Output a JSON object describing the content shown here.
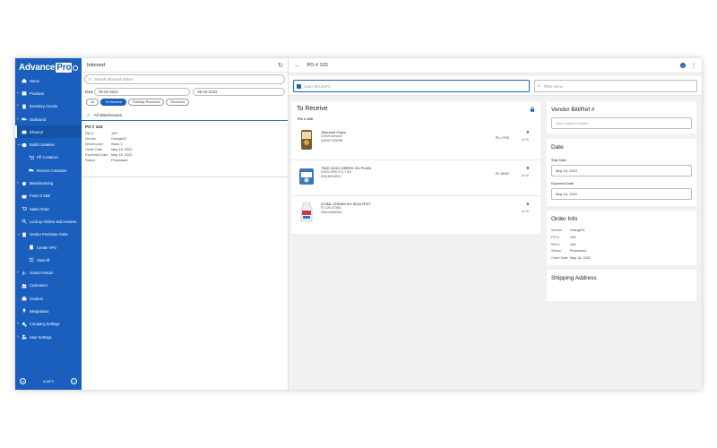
{
  "app": {
    "brand": "Advance",
    "brand_pro": "Pro"
  },
  "nav": [
    {
      "label": "Home",
      "icon": "home-icon",
      "chev": ""
    },
    {
      "label": "Products",
      "icon": "box-icon",
      "chev": "›"
    },
    {
      "label": "Inventory Counts",
      "icon": "clipboard-icon",
      "chev": "›"
    },
    {
      "label": "Outbound",
      "icon": "truck-icon",
      "chev": "›"
    },
    {
      "label": "Inbound",
      "icon": "inbox-icon",
      "chev": "",
      "active": true
    },
    {
      "label": "Build Container",
      "icon": "cube-icon",
      "chev": "⌄"
    },
    {
      "label": "Fill Container",
      "icon": "cart-icon",
      "chev": "",
      "sub": true
    },
    {
      "label": "Receive Container",
      "icon": "truck-icon",
      "chev": "",
      "sub": true
    },
    {
      "label": "Manufacturing",
      "icon": "gear-icon",
      "chev": "›"
    },
    {
      "label": "Point of Sale",
      "icon": "store-icon",
      "chev": ""
    },
    {
      "label": "Sales Order",
      "icon": "cart-icon",
      "chev": ""
    },
    {
      "label": "Look up Orders and Invoices",
      "icon": "search-icon",
      "chev": ""
    },
    {
      "label": "Vendor Purchase Order",
      "icon": "doc-icon",
      "chev": "⌄"
    },
    {
      "label": "Create VPO",
      "icon": "doc-icon",
      "chev": "",
      "sub": true
    },
    {
      "label": "View All",
      "icon": "list-icon",
      "chev": "",
      "sub": true
    },
    {
      "label": "Vendor Return",
      "icon": "return-icon",
      "chev": "›"
    },
    {
      "label": "Customers",
      "icon": "users-icon",
      "chev": ""
    },
    {
      "label": "Vendors",
      "icon": "vendor-icon",
      "chev": ""
    },
    {
      "label": "Integrations",
      "icon": "plug-icon",
      "chev": ""
    },
    {
      "label": "Company Settings",
      "icon": "gears-icon",
      "chev": "›"
    },
    {
      "label": "User Settings",
      "icon": "user-gear-icon",
      "chev": "›"
    }
  ],
  "footer": {
    "initials": "A",
    "user": "d-WFX",
    "help": "?"
  },
  "inbound": {
    "title": "Inbound",
    "search_placeholder": "Search Inbound orders",
    "date_label": "Date",
    "date_from": "05-02-2022",
    "date_to": "05-16-2022",
    "chips": [
      {
        "label": "All",
        "on": false
      },
      {
        "label": "To Receive",
        "on": true
      },
      {
        "label": "Partially Received",
        "on": false
      },
      {
        "label": "Received",
        "on": false
      }
    ],
    "warehouse": "All Warehouses",
    "order": {
      "po": "PO # 103",
      "rows": [
        {
          "k": "Ref #",
          "v": "149"
        },
        {
          "k": "Vendor",
          "v": "Orange21"
        },
        {
          "k": "Warehouse",
          "v": "Store 1"
        },
        {
          "k": "Order Date",
          "v": "May 16, 2022"
        },
        {
          "k": "Expected Date",
          "v": "May 16, 2022"
        },
        {
          "k": "Status",
          "v": "Processed"
        }
      ]
    }
  },
  "detail": {
    "title": "PO # 103",
    "scan_placeholder": "Scan SKU/UPC",
    "filter_placeholder": "Filter items",
    "receive_title": "To Receive",
    "receive_po": "PO # 103",
    "items": [
      {
        "name": "Jinbound Chips",
        "sku": "01949 Armond",
        "upc": "042007105098",
        "loc": "PL =7H3",
        "qty": "0",
        "of": "of 10"
      },
      {
        "name": "750G IOGO GREEK 0% PLAIN",
        "sku": "IOGO-GRK-P-0-7 5G",
        "upc": "051189108017",
        "loc": "PL WHG",
        "qty": "0",
        "of": "of 10"
      },
      {
        "name": "473ML CREAM 5% SEALTEST",
        "sku": "ST-CR-473ML",
        "upc": "056142882341",
        "loc": "",
        "qty": "0",
        "of": "of 10"
      }
    ],
    "vendor_bill": {
      "title": "Vendor Bill/Ref #",
      "placeholder": "Add a bill/ref number"
    },
    "date_card": {
      "title": "Date",
      "ship_label": "Ship Date",
      "ship": "May 16, 2022",
      "exp_label": "Expected Date",
      "exp": "May 16, 2022"
    },
    "order_info": {
      "title": "Order Info",
      "rows": [
        {
          "k": "Vendor",
          "v": "Orange21"
        },
        {
          "k": "PO #",
          "v": "103"
        },
        {
          "k": "Ref #",
          "v": "149"
        },
        {
          "k": "Status",
          "v": "Processed"
        },
        {
          "k": "Order Date",
          "v": "May 16, 2022"
        }
      ]
    },
    "shipping": {
      "title": "Shipping Address"
    }
  }
}
